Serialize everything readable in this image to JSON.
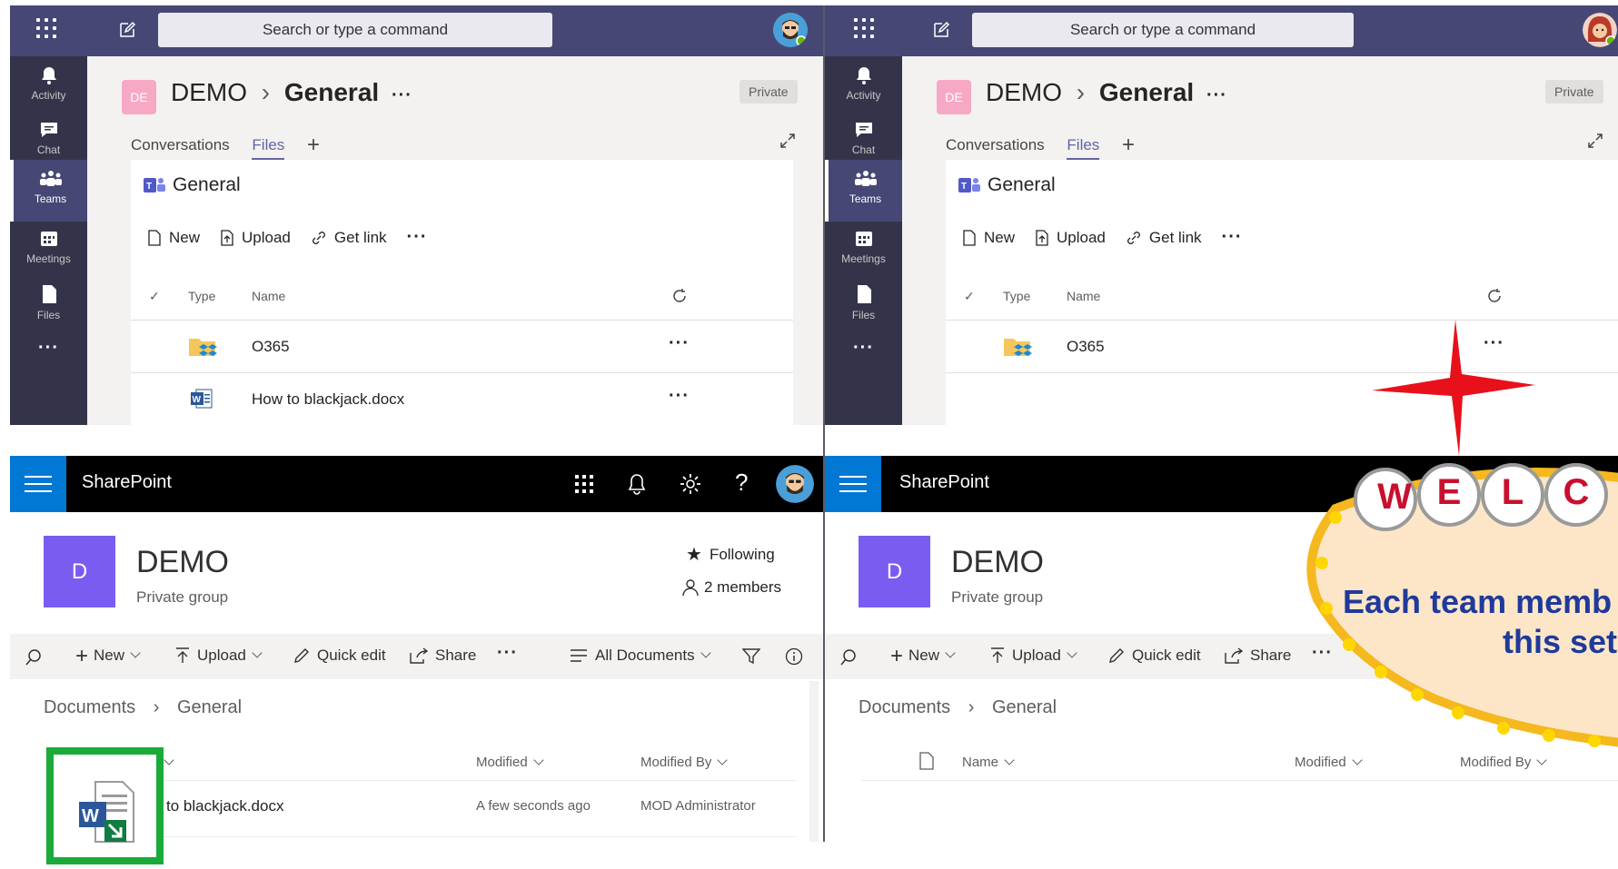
{
  "teams": {
    "search_placeholder": "Search or type a command",
    "rail": [
      "Activity",
      "Chat",
      "Teams",
      "Meetings",
      "Files"
    ],
    "team_badge": "DE",
    "team_name": "DEMO",
    "channel_name": "General",
    "privacy": "Private",
    "tabs": [
      "Conversations",
      "Files"
    ],
    "files_title": "General",
    "commands": [
      "New",
      "Upload",
      "Get link"
    ],
    "col_type": "Type",
    "col_name": "Name",
    "files": [
      "O365",
      "How to blackjack.docx"
    ]
  },
  "sharepoint": {
    "brand": "SharePoint",
    "site_logo": "D",
    "site_name": "DEMO",
    "site_type": "Private group",
    "following": "Following",
    "members": "2 members",
    "commands": [
      "New",
      "Upload",
      "Quick edit",
      "Share"
    ],
    "view": "All Documents",
    "breadcrumb_root": "Documents",
    "breadcrumb_folder": "General",
    "col_name": "Name",
    "col_modified": "Modified",
    "col_modified_by": "Modified By",
    "file_name_partial": "w to blackjack.docx",
    "file_modified": "A few seconds ago",
    "file_modified_by": "MOD Administrator"
  },
  "overlay": {
    "welcome_letters": [
      "W",
      "E",
      "L",
      "C"
    ],
    "message_line1": "Each team memb",
    "message_line2": "this set"
  },
  "colors": {
    "teams_header": "#464775",
    "teams_rail": "#33344a",
    "teams_accent": "#6264a7",
    "sp_blue": "#0078d4",
    "sp_logo": "#7b5cf0",
    "highlight_green": "#1aaa3a",
    "star_red": "#e8101a",
    "welcome_text": "#1f3a9a"
  }
}
